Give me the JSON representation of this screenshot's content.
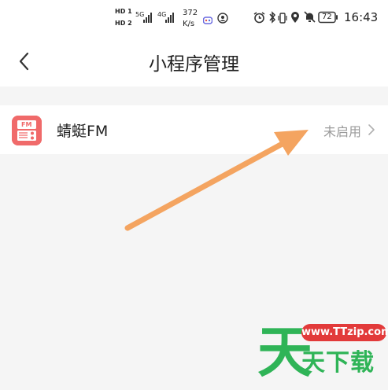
{
  "status_bar": {
    "sim1": "HD 1",
    "sim2": "HD 2",
    "net1": "5G",
    "net2": "4G",
    "speed_value": "372",
    "speed_unit": "K/s",
    "battery": "72",
    "time": "16:43"
  },
  "nav": {
    "title": "小程序管理"
  },
  "mini_programs": [
    {
      "name": "蜻蜓FM",
      "status": "未启用",
      "icon_text": "FM"
    }
  ],
  "watermark": {
    "big_char": "天",
    "url": "www.TTzip.com",
    "subtitle": "天下载"
  },
  "colors": {
    "arrow": "#f4a460",
    "app_icon": "#f06a6a",
    "watermark_green": "#2fb457",
    "watermark_red": "#e23a3a"
  }
}
